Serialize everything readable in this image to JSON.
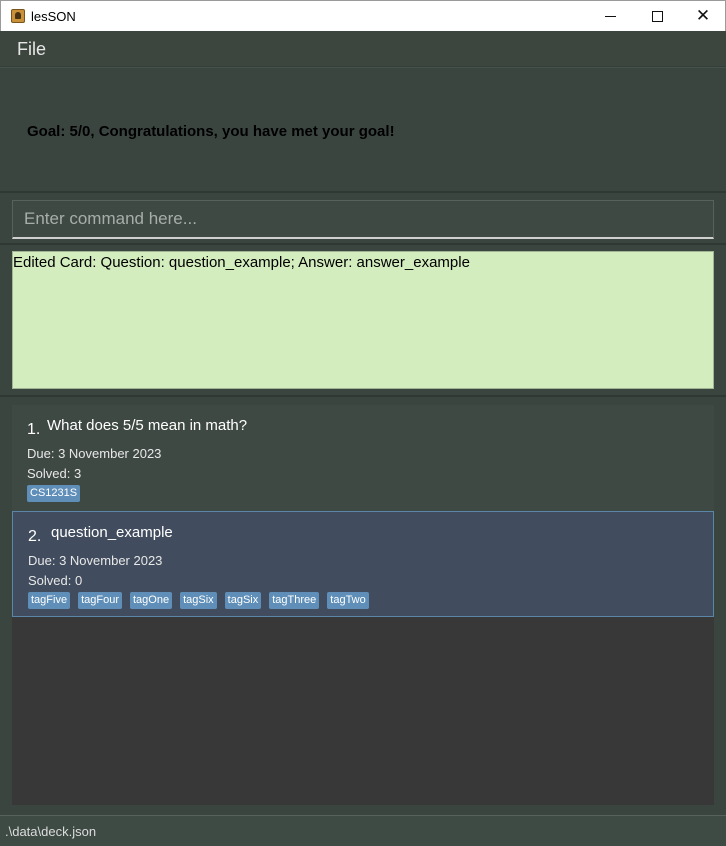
{
  "window": {
    "title": "lesSON",
    "close_glyph": "✕"
  },
  "menu": {
    "file_label": "File"
  },
  "goal": {
    "text": "Goal: 5/0, Congratulations, you have met your goal!"
  },
  "command": {
    "placeholder": "Enter command here...",
    "value": ""
  },
  "result": {
    "text": "Edited Card: Question: question_example; Answer: answer_example"
  },
  "cards": [
    {
      "index": "1.",
      "question": "What does 5/5 mean in math?",
      "due": "Due: 3 November 2023",
      "solved": "Solved: 3",
      "tags": [
        "CS1231S"
      ]
    },
    {
      "index": "2.",
      "question": "question_example",
      "due": "Due: 3 November 2023",
      "solved": "Solved: 0",
      "tags": [
        "tagFive",
        "tagFour",
        "tagOne",
        "tagSix",
        "tagSix",
        "tagThree",
        "tagTwo"
      ]
    }
  ],
  "status": {
    "path": ".\\data\\deck.json"
  },
  "colors": {
    "result_bg": "#d3edbf",
    "tag_bg": "#5f8fb8",
    "selected_card_bg": "#414d5e",
    "panel_bg": "#3b4540"
  }
}
